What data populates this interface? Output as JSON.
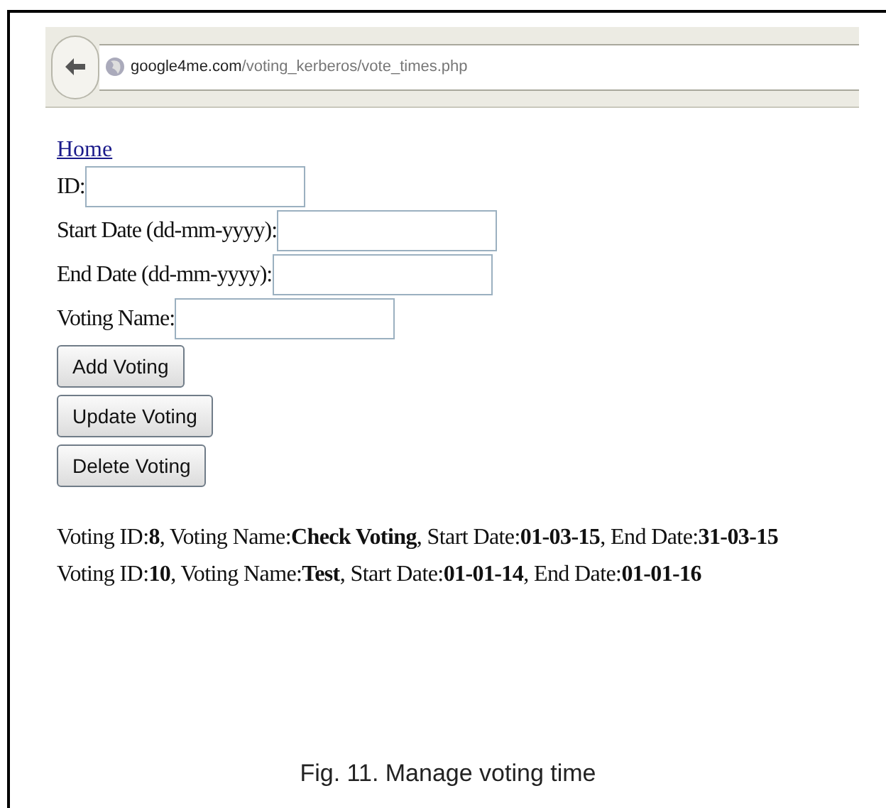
{
  "address_bar": {
    "domain": "google4me.com",
    "path": "/voting_kerberos/vote_times.php"
  },
  "home_link": "Home",
  "fields": [
    {
      "label": "ID:"
    },
    {
      "label": "Start Date (dd-mm-yyyy):"
    },
    {
      "label": "End Date (dd-mm-yyyy):"
    },
    {
      "label": "Voting Name:"
    }
  ],
  "buttons": [
    "Add Voting",
    "Update Voting",
    "Delete Voting"
  ],
  "records": [
    "Voting ID:**8**, Voting Name:**Check Voting**, Start Date:**01-03-15**, End Date:**31-03-15**",
    "Voting ID:**10**, Voting Name:**Test**, Start Date:**01-01-14**, End Date:**01-01-16**"
  ],
  "caption": "Fig. 11. Manage voting time"
}
